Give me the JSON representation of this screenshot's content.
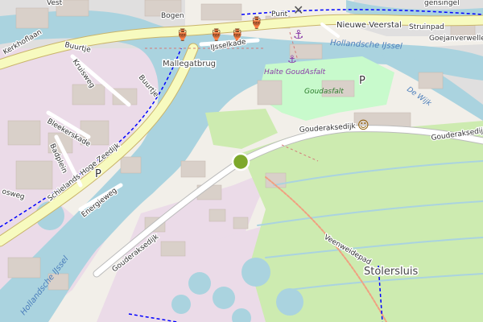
{
  "map": {
    "colors": {
      "background": "#f2efe9",
      "water": "#aad3df",
      "industrial": "#ebdbe8",
      "residential": "#e0dfdf",
      "meadow": "#cdebb0",
      "park": "#c8facc",
      "primary_road": "#fcd6a4",
      "secondary_road": "#f7fabf",
      "building": "#d9d0c9",
      "cycleway": "#0000ff"
    },
    "labels": {
      "vest": "Vest",
      "bogen": "Bogen",
      "punt": "Punt",
      "gensingel": "gensingel",
      "nieuwe_veerstal": "Nieuwe Veerstal",
      "struinpad": "Struinpad",
      "goejanverwellesluis": "Goejanverwellesluis",
      "kerkhoflaan": "Kerkhoflaan",
      "buurtje": "Buurtje",
      "kruisweg": "Kruisweg",
      "ijsselkade": "IJsselkade",
      "mallegatbrug": "Mallegatbrug",
      "hollandsche_ijssel_top": "Hollandsche IJssel",
      "halte_goudasfalt": "Halte GoudAsfalt",
      "goudasfalt": "Goudasfalt",
      "de_wijk": "De Wijk",
      "buurtje_2": "Buurtje",
      "bleekerskade": "Bleekerskade",
      "badplein": "Badplein",
      "gouderaksedijk_1": "Gouderaksedijk",
      "gouderaksedijk_2": "Gouderaksedijk",
      "schielands_hoge_zeedijk": "Schielands Hoge Zeedijk",
      "veenweidepad": "Veenweidepad",
      "energieweg": "Energieweg",
      "gouderaksedijk_3": "Gouderaksedijk",
      "stolersluis": "Stolersluis",
      "hollandsche_ijssel_bottom": "Hollandsche IJssel",
      "osweg": "osweg",
      "p1": "P",
      "p2": "P"
    },
    "icons": [
      "windmill-icon",
      "anchor-icon",
      "cocktail-icon",
      "theatre-icon",
      "marker-icon"
    ]
  }
}
